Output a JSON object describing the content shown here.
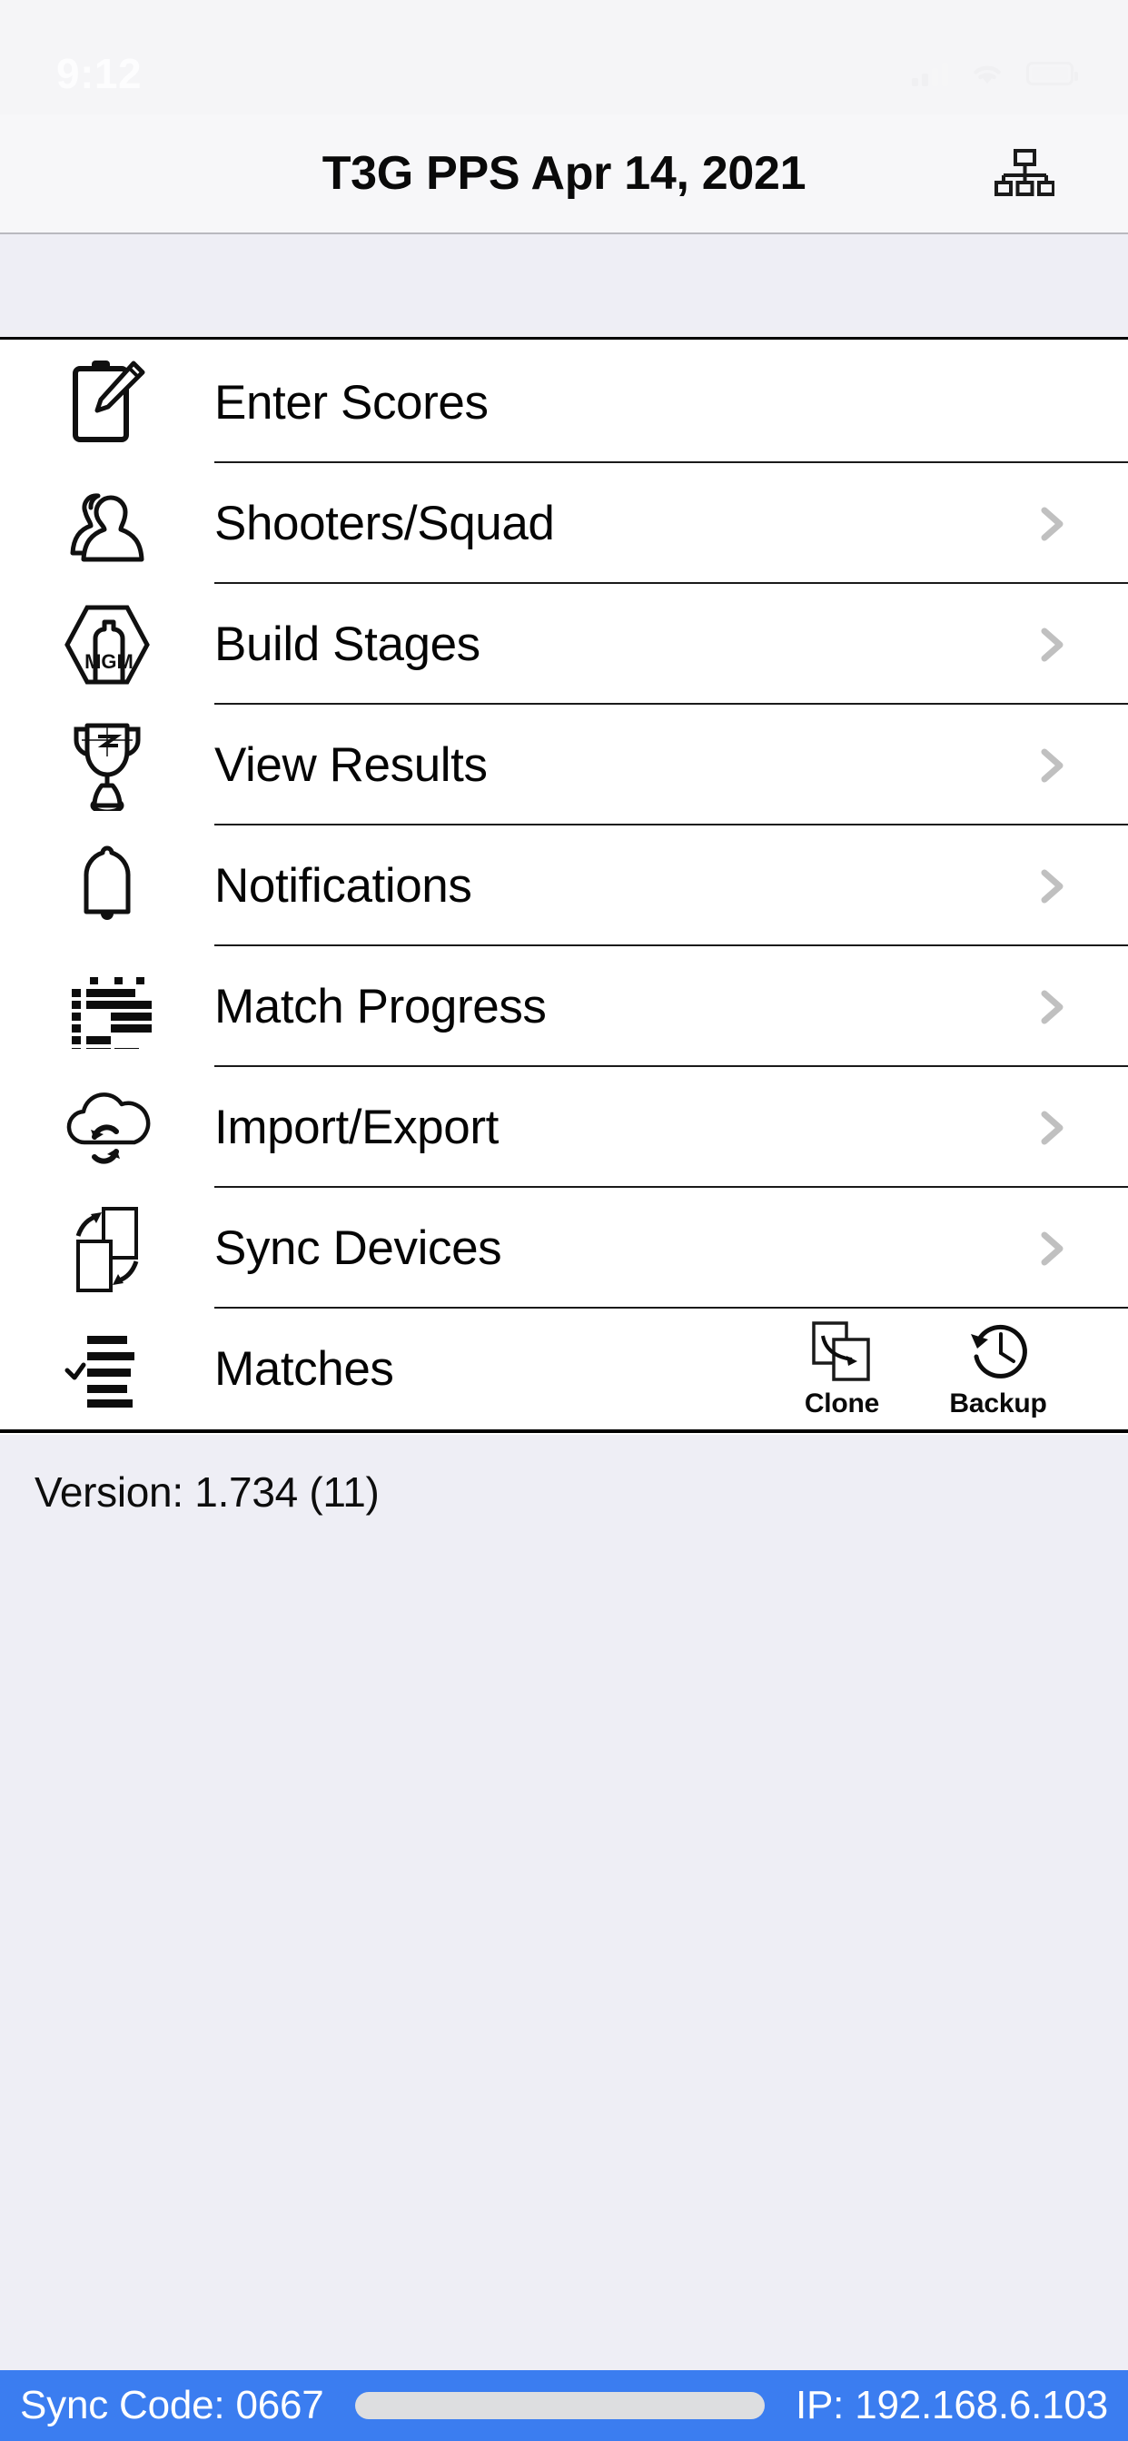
{
  "status_bar": {
    "time": "9:12",
    "signal_icon": "cellular-signal-icon",
    "wifi_icon": "wifi-icon",
    "battery_icon": "battery-icon"
  },
  "nav": {
    "title": "T3G PPS Apr 14, 2021",
    "right_icon": "network-hierarchy-icon"
  },
  "section_band": {
    "label": ""
  },
  "menu": {
    "items": [
      {
        "label": "Enter Scores",
        "icon": "clipboard-pencil-icon",
        "chevron": false
      },
      {
        "label": "Shooters/Squad",
        "icon": "two-people-icon",
        "chevron": true
      },
      {
        "label": "Build Stages",
        "icon": "mgm-target-icon",
        "chevron": true
      },
      {
        "label": "View Results",
        "icon": "trophy-icon",
        "chevron": true
      },
      {
        "label": "Notifications",
        "icon": "bell-icon",
        "chevron": true
      },
      {
        "label": "Match Progress",
        "icon": "progress-grid-icon",
        "chevron": true
      },
      {
        "label": "Import/Export",
        "icon": "cloud-sync-icon",
        "chevron": true
      },
      {
        "label": "Sync Devices",
        "icon": "devices-sync-icon",
        "chevron": true
      },
      {
        "label": "Matches",
        "icon": "checklist-icon",
        "chevron": false
      }
    ],
    "matches_actions": [
      {
        "label": "Clone",
        "icon": "copy-duplicate-icon"
      },
      {
        "label": "Backup",
        "icon": "clock-history-icon"
      }
    ]
  },
  "footer": {
    "version": "Version: 1.734 (11)"
  },
  "sync_bar": {
    "sync_code": "Sync Code: 0667",
    "ip": "IP: 192.168.6.103",
    "progress_icon": "progress-pill"
  },
  "colors": {
    "sync_bar_blue": "#3b7df0",
    "section_band": "#eeeef5",
    "nav_bg": "#f7f7f9",
    "chevron_gray": "#c0c0c0",
    "progress_pill": "#dddee0"
  }
}
